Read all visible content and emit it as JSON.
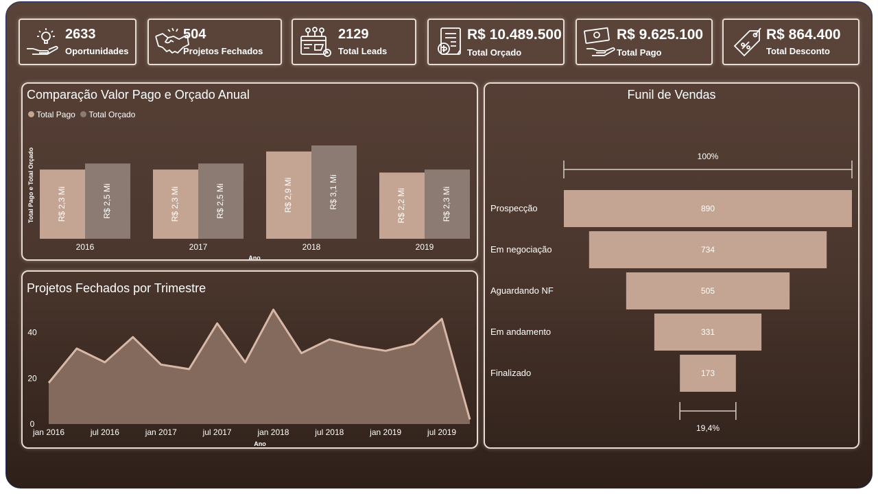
{
  "kpis": [
    {
      "value": "2633",
      "label": "Oportunidades",
      "icon": "lightbulb-hand-icon"
    },
    {
      "value": "504",
      "label": "Projetos Fechados",
      "icon": "handshake-icon"
    },
    {
      "value": "2129",
      "label": "Total Leads",
      "icon": "leads-dashboard-icon"
    },
    {
      "value": "R$ 10.489.500",
      "label": "Total Orçado",
      "icon": "budget-document-icon"
    },
    {
      "value": "R$ 9.625.100",
      "label": "Total Pago",
      "icon": "money-hand-icon"
    },
    {
      "value": "R$ 864.400",
      "label": "Total Desconto",
      "icon": "discount-tag-icon"
    }
  ],
  "colors": {
    "pago": "#c4a493",
    "orcado": "#8c7b73",
    "area": "#846a5d",
    "line": "#d7b7a6",
    "text": "#ffffff"
  },
  "chart_data": [
    {
      "type": "bar",
      "title": "Comparação Valor Pago e Orçado Anual",
      "xlabel": "Ano",
      "ylabel": "Total Pago e Total Orçado",
      "legend_position": "top-left",
      "categories": [
        "2016",
        "2017",
        "2018",
        "2019"
      ],
      "series": [
        {
          "name": "Total Pago",
          "values": [
            2.3,
            2.3,
            2.9,
            2.2
          ],
          "labels": [
            "R$ 2,3 Mi",
            "R$ 2,3 Mi",
            "R$ 2,9 Mi",
            "R$ 2,2 Mi"
          ]
        },
        {
          "name": "Total Orçado",
          "values": [
            2.5,
            2.5,
            3.1,
            2.3
          ],
          "labels": [
            "R$ 2,5 Mi",
            "R$ 2,5 Mi",
            "R$ 3,1 Mi",
            "R$ 2,3 Mi"
          ]
        }
      ],
      "ylim": [
        0,
        3.1
      ]
    },
    {
      "type": "area",
      "title": "Projetos Fechados por Trimestre",
      "xlabel": "Ano",
      "x": [
        "2016-01",
        "2016-04",
        "2016-07",
        "2016-10",
        "2017-01",
        "2017-04",
        "2017-07",
        "2017-10",
        "2018-01",
        "2018-04",
        "2018-07",
        "2018-10",
        "2019-01",
        "2019-04",
        "2019-07",
        "2019-10"
      ],
      "values": [
        18,
        33,
        27,
        38,
        26,
        24,
        44,
        27,
        50,
        31,
        37,
        34,
        32,
        35,
        46,
        2
      ],
      "xticks": [
        "jan 2016",
        "jul 2016",
        "jan 2017",
        "jul 2017",
        "jan 2018",
        "jul 2018",
        "jan 2019",
        "jul 2019"
      ],
      "yticks": [
        0,
        20,
        40
      ],
      "ylim": [
        0,
        54
      ],
      "grid": false
    },
    {
      "type": "funnel",
      "title": "Funil de Vendas",
      "stages": [
        "Prospecção",
        "Em negociação",
        "Aguardando NF",
        "Em andamento",
        "Finalizado"
      ],
      "values": [
        890,
        734,
        505,
        331,
        173
      ],
      "top_label": "100%",
      "bottom_label": "19,4%"
    }
  ]
}
